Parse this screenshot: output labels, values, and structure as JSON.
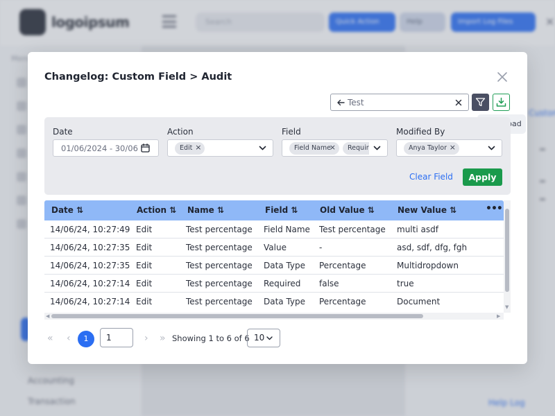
{
  "background": {
    "logo_text": "logoipsum",
    "search_placeholder": "Search",
    "button_1": "Quick Action",
    "button_2": "Help",
    "button_3": "Import Log Files",
    "sidebar_heading": "Menu",
    "sidebar_items": [
      "Accounting",
      "Transaction"
    ],
    "right_link": "Customise",
    "help_text": "Help Log",
    "accent": "#2b6ef2"
  },
  "modal": {
    "title": "Changelog: Custom Field > Audit",
    "close_icon": "close-icon",
    "search": {
      "value": "Test",
      "back_icon": "arrow-left-icon",
      "clear_icon": "close-icon"
    },
    "filter_icon": "filter-icon",
    "download_icon": "download-icon",
    "download_tooltip": "Download",
    "filters": {
      "date": {
        "label": "Date",
        "value": "01/06/2024 - 30/06",
        "icon": "calendar-icon"
      },
      "action": {
        "label": "Action",
        "chips": [
          "Edit"
        ]
      },
      "field": {
        "label": "Field",
        "chips": [
          "Field Name",
          "Required"
        ]
      },
      "modified_by": {
        "label": "Modified By",
        "chips": [
          "Anya Taylor"
        ]
      },
      "clear_label": "Clear Field",
      "apply_label": "Apply"
    },
    "table": {
      "columns": [
        "Date ⇅",
        "Action ⇅",
        "Name ⇅",
        "Field ⇅",
        "Old Value ⇅",
        "New Value ⇅"
      ],
      "more_label": "•••",
      "header_color": "#8fb8f7",
      "rows": [
        [
          "14/06/24, 10:27:49",
          "Edit",
          "Test percentage",
          "Field Name",
          "Test percentage",
          "multi asdf"
        ],
        [
          "14/06/24, 10:27:35",
          "Edit",
          "Test percentage",
          "Value",
          "-",
          "asd, sdf, dfg, fgh"
        ],
        [
          "14/06/24, 10:27:35",
          "Edit",
          "Test percentage",
          "Data Type",
          "Percentage",
          "Multidropdown"
        ],
        [
          "14/06/24, 10:27:14",
          "Edit",
          "Test percentage",
          "Required",
          "false",
          "true"
        ],
        [
          "14/06/24, 10:27:14",
          "Edit",
          "Test percentage",
          "Data Type",
          "Percentage",
          "Document"
        ]
      ]
    },
    "pagination": {
      "first": "«",
      "prev": "‹",
      "current_page": "1",
      "page_input": "1",
      "next": "›",
      "last": "»",
      "info": "Showing 1 to 6 of 6",
      "page_size": "10"
    },
    "apply_color": "#1a9a4c"
  }
}
